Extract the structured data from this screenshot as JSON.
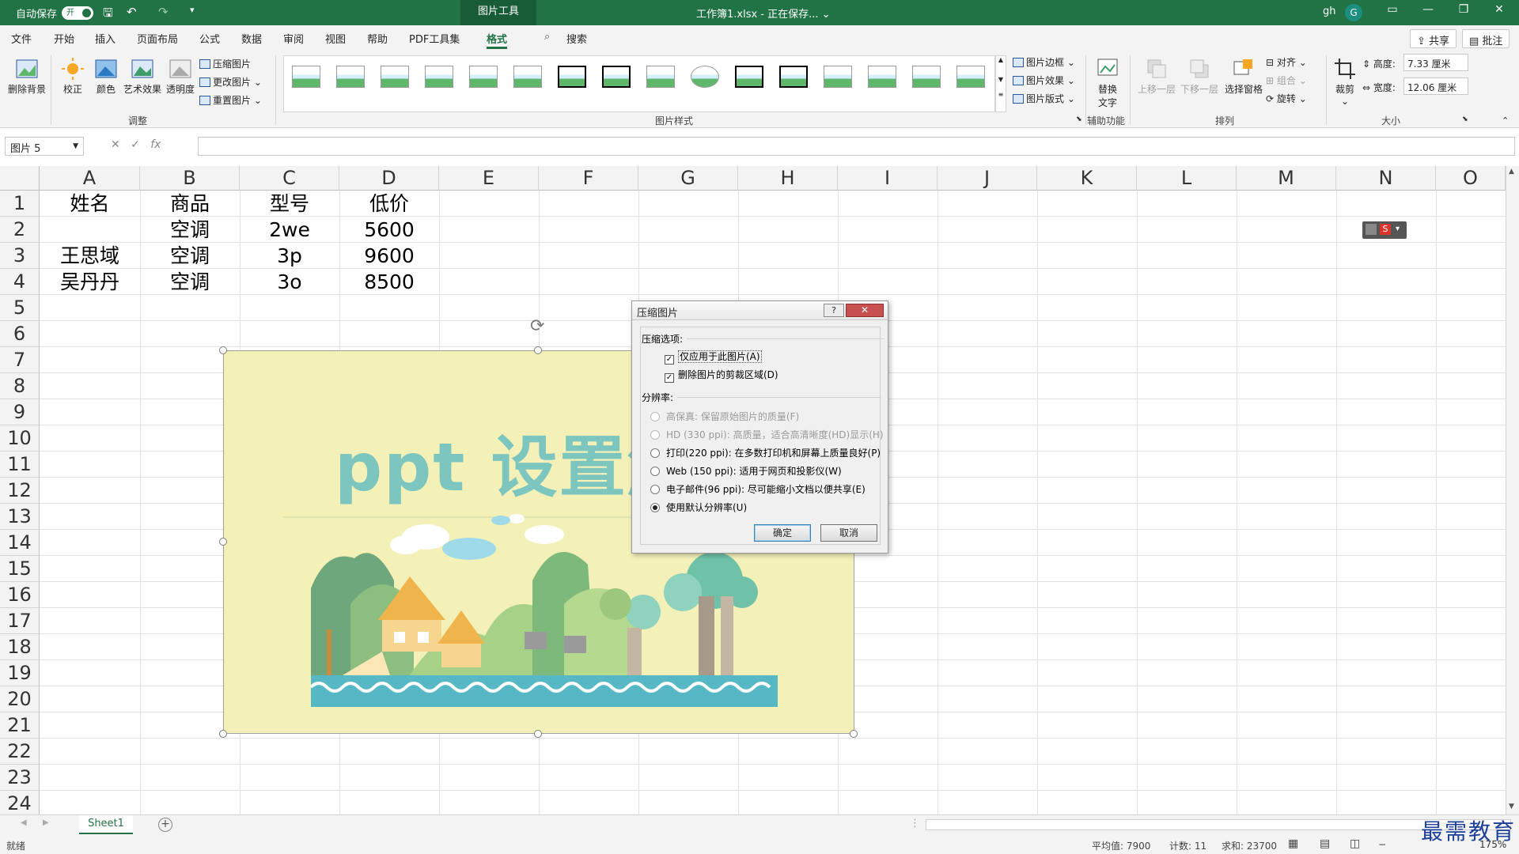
{
  "titlebar": {
    "autosave_label": "自动保存",
    "autosave_state": "开",
    "context_tab": "图片工具",
    "document_title": "工作簿1.xlsx - 正在保存... ⌄",
    "user_name": "gh",
    "user_initial": "G"
  },
  "tabs": [
    "文件",
    "开始",
    "插入",
    "页面布局",
    "公式",
    "数据",
    "审阅",
    "视图",
    "帮助",
    "PDF工具集",
    "格式"
  ],
  "search_label": "搜索",
  "share_label": "共享",
  "comment_label": "批注",
  "ribbon": {
    "remove_bg": "删除背景",
    "corrections": "校正",
    "color": "颜色",
    "artistic": "艺术效果",
    "transparency": "透明度",
    "compress": "压缩图片",
    "change_pic": "更改图片",
    "reset_pic": "重置图片",
    "group_adjust": "调整",
    "group_styles": "图片样式",
    "border": "图片边框",
    "effects": "图片效果",
    "layout": "图片版式",
    "alt_text": "替换文字",
    "group_access": "辅助功能",
    "bring_forward": "上移一层",
    "send_backward": "下移一层",
    "selection_pane": "选择窗格",
    "align": "对齐",
    "group": "组合",
    "rotate": "旋转",
    "group_arrange": "排列",
    "crop": "裁剪",
    "height_label": "高度:",
    "height_value": "7.33 厘米",
    "width_label": "宽度:",
    "width_value": "12.06 厘米",
    "group_size": "大小"
  },
  "formula_bar": {
    "name_box": "图片 5",
    "fx": "fx"
  },
  "columns": [
    "A",
    "B",
    "C",
    "D",
    "E",
    "F",
    "G",
    "H",
    "I",
    "J",
    "K",
    "L",
    "M",
    "N",
    "O"
  ],
  "rows": [
    "1",
    "2",
    "3",
    "4",
    "5",
    "6",
    "7",
    "8",
    "9",
    "10",
    "11",
    "12",
    "13",
    "14",
    "15",
    "16",
    "17",
    "18",
    "19",
    "20",
    "21",
    "22",
    "23",
    "24"
  ],
  "cells": {
    "A1": "姓名",
    "B1": "商品",
    "C1": "型号",
    "D1": "低价",
    "B2": "空调",
    "C2": "2we",
    "D2": "5600",
    "A3": "王思域",
    "B3": "空调",
    "C3": "3p",
    "D3": "9600",
    "A4": "吴丹丹",
    "B4": "空调",
    "C4": "3o",
    "D4": "8500"
  },
  "picture": {
    "title": "ppt 设置触"
  },
  "dialog": {
    "title": "压缩图片",
    "help": "?",
    "close": "✕",
    "compress_options": "压缩选项:",
    "apply_only": "仅应用于此图片(A)",
    "delete_cropped": "删除图片的剪裁区域(D)",
    "resolution": "分辨率:",
    "opt_hifi": "高保真: 保留原始图片的质量(F)",
    "opt_hd": "HD (330 ppi): 高质量，适合高清晰度(HD)显示(H)",
    "opt_print": "打印(220 ppi): 在多数打印机和屏幕上质量良好(P)",
    "opt_web": "Web (150 ppi): 适用于网页和投影仪(W)",
    "opt_email": "电子邮件(96 ppi): 尽可能缩小文档以便共享(E)",
    "opt_default": "使用默认分辨率(U)",
    "ok": "确定",
    "cancel": "取消"
  },
  "sheet_tab": "Sheet1",
  "status": {
    "ready": "就绪",
    "average": "平均值: 7900",
    "count": "计数: 11",
    "sum": "求和: 23700",
    "zoom": "175%"
  },
  "watermark": "最需教育"
}
